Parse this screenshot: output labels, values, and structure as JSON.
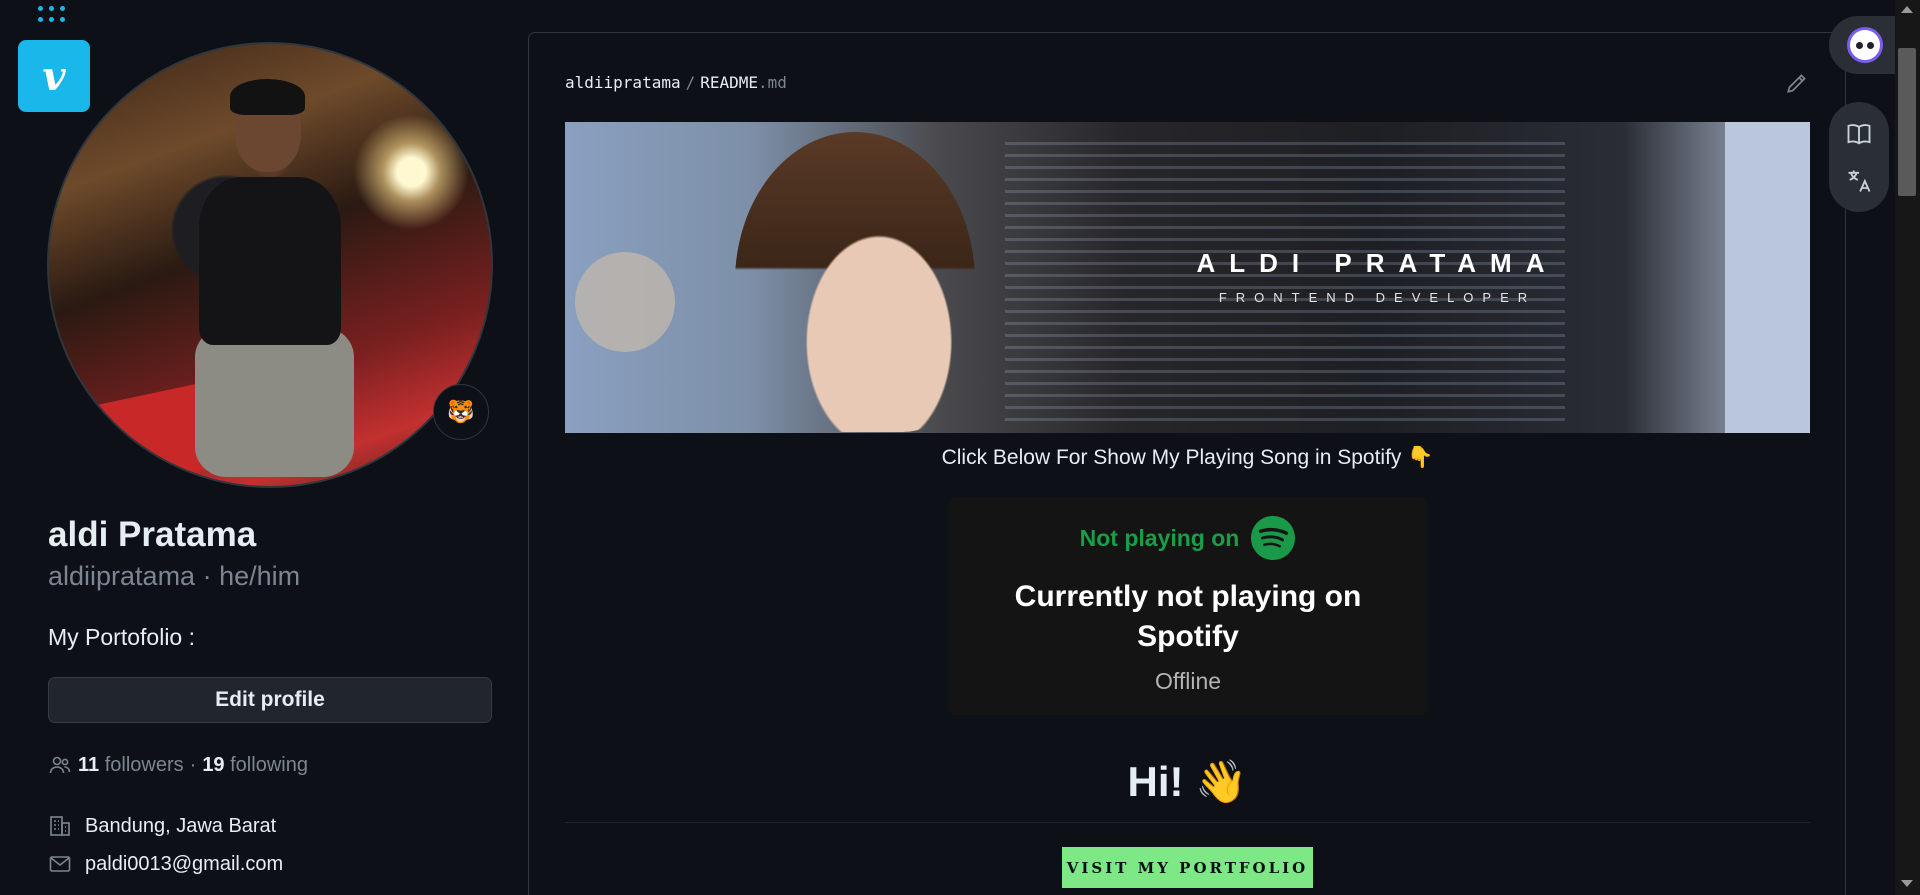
{
  "profile": {
    "name": "aldi Pratama",
    "login_line": "aldiipratama · he/him",
    "bio": "My Portofolio :",
    "status_emoji": "🐯",
    "edit_button": "Edit profile",
    "followers_count": "11",
    "followers_label": "followers",
    "separator": "·",
    "following_count": "19",
    "following_label": "following",
    "location": "Bandung, Jawa Barat",
    "email": "paldi0013@gmail.com"
  },
  "readme": {
    "owner": "aldiipratama",
    "separator": "/",
    "file_base": "README",
    "file_ext": ".md",
    "banner_title": "ALDI PRATAMA",
    "banner_subtitle": "FRONTEND DEVELOPER",
    "spotify_caption": "Click Below For Show My Playing Song in Spotify 👇",
    "spotify": {
      "status": "Not playing on",
      "headline": "Currently not playing on Spotify",
      "sub": "Offline",
      "brand_color": "#1db954"
    },
    "greeting": "Hi! 👋",
    "visit_button": "VISIT MY PORTFOLIO"
  },
  "icons": {
    "vimeo_letter": "v",
    "location_icon": "building-icon",
    "email_icon": "mail-icon",
    "people_icon": "people-icon",
    "edit_icon": "pencil-icon",
    "read_icon": "book-icon",
    "translate_icon": "translate-icon"
  },
  "colors": {
    "background": "#0d1117",
    "vimeo": "#1ab7ea",
    "visit_button": "#7de885"
  }
}
